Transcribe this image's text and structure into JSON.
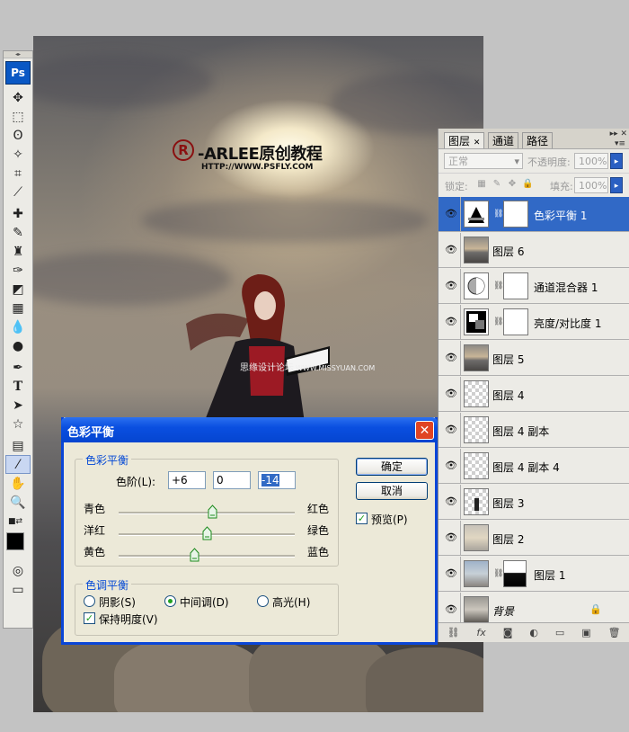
{
  "canvas": {
    "watermark_title": "-ARLEE原创教程",
    "watermark_logo": "R",
    "watermark_url": "HTTP://WWW.PSFLY.COM",
    "watermark2_cn": "思缘设计论坛",
    "watermark2_url": "WWW.MISSYUAN.COM"
  },
  "toolbox": {
    "logo": "Ps",
    "tools": [
      "move-tool",
      "marquee-tool",
      "lasso-tool",
      "magic-wand-tool",
      "crop-tool",
      "slice-tool",
      "healing-brush-tool",
      "brush-tool",
      "clone-stamp-tool",
      "history-brush-tool",
      "eraser-tool",
      "gradient-tool",
      "blur-tool",
      "dodge-tool",
      "pen-tool",
      "type-tool",
      "path-selection-tool",
      "shape-tool",
      "notes-tool",
      "eyedropper-tool",
      "hand-tool",
      "zoom-tool"
    ],
    "foreground_color": "#000000",
    "background_color": "#ffffff"
  },
  "layers_panel": {
    "tabs": [
      "图层",
      "通道",
      "路径"
    ],
    "active_tab": "图层",
    "blend_mode": "正常",
    "opacity_label": "不透明度:",
    "opacity_value": "100%",
    "lock_label": "锁定:",
    "fill_label": "填充:",
    "fill_value": "100%",
    "layers": [
      {
        "name": "色彩平衡 1",
        "kind": "adjustment",
        "selected": true
      },
      {
        "name": "图层 6",
        "kind": "photo",
        "selected": false
      },
      {
        "name": "通道混合器 1",
        "kind": "adjustment",
        "selected": false
      },
      {
        "name": "亮度/对比度 1",
        "kind": "adjustment",
        "selected": false
      },
      {
        "name": "图层 5",
        "kind": "photo",
        "selected": false
      },
      {
        "name": "图层 4",
        "kind": "transparent",
        "selected": false
      },
      {
        "name": "图层 4 副本",
        "kind": "transparent",
        "selected": false
      },
      {
        "name": "图层 4 副本 4",
        "kind": "transparent",
        "selected": false
      },
      {
        "name": "图层 3",
        "kind": "transparent",
        "selected": false
      },
      {
        "name": "图层 2",
        "kind": "photo",
        "selected": false
      },
      {
        "name": "图层 1",
        "kind": "photo-mask",
        "selected": false
      },
      {
        "name": "背景",
        "kind": "background",
        "selected": false,
        "locked": true
      }
    ]
  },
  "dialog": {
    "title": "色彩平衡",
    "color_balance_group": "色彩平衡",
    "levels_label": "色阶(L):",
    "levels": [
      "+6",
      "0",
      "-14"
    ],
    "sliders": [
      {
        "left": "青色",
        "right": "红色",
        "value": 6
      },
      {
        "left": "洋红",
        "right": "绿色",
        "value": 0
      },
      {
        "left": "黄色",
        "right": "蓝色",
        "value": -14
      }
    ],
    "slider_range": [
      -100,
      100
    ],
    "tone_group": "色调平衡",
    "tones": [
      {
        "label": "阴影(S)",
        "checked": false
      },
      {
        "label": "中间调(D)",
        "checked": true
      },
      {
        "label": "高光(H)",
        "checked": false
      }
    ],
    "preserve_luminosity": "保持明度(V)",
    "preserve_checked": true,
    "ok_button": "确定",
    "cancel_button": "取消",
    "preview_label": "预览(P)",
    "preview_checked": true
  }
}
